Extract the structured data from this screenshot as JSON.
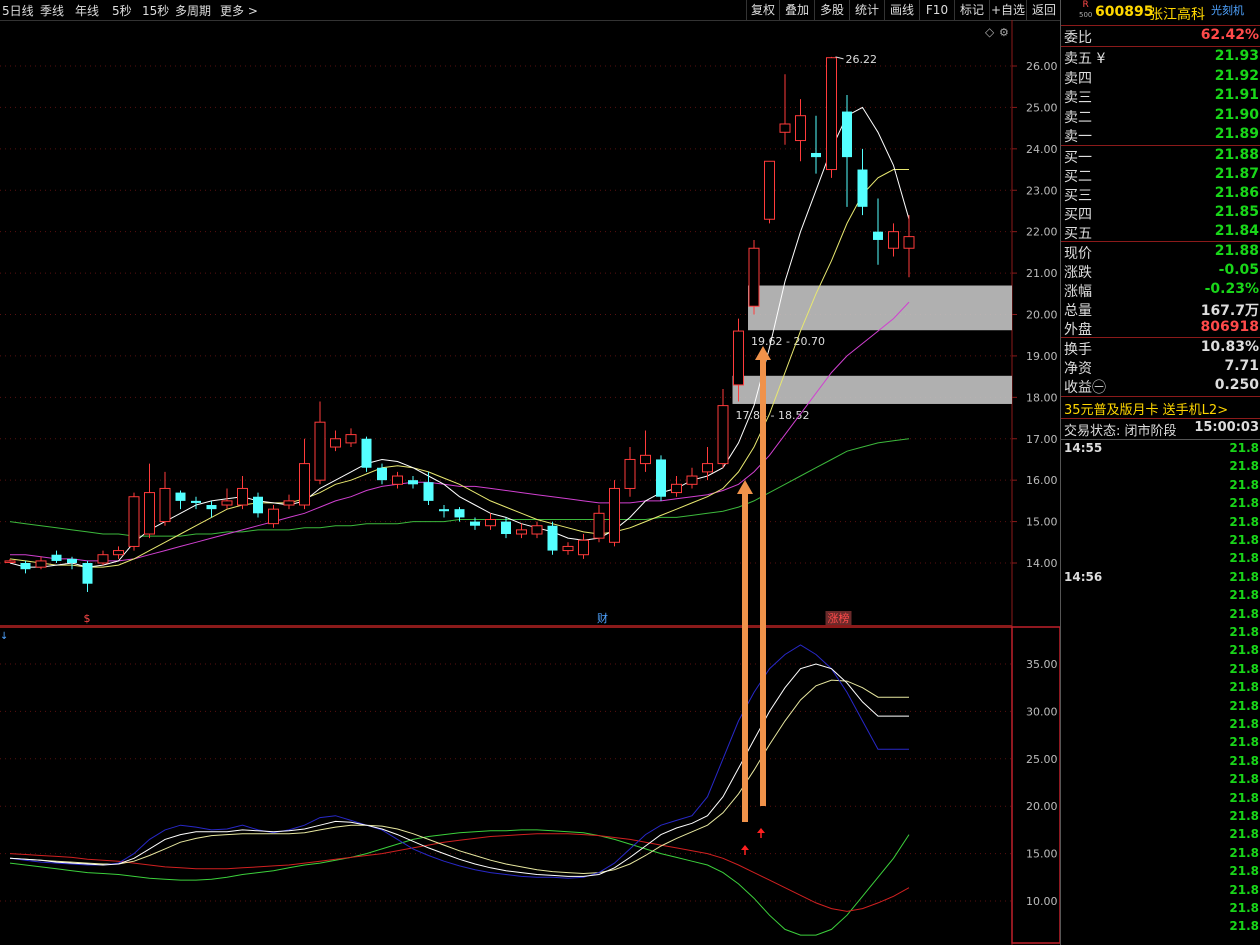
{
  "toolbar": {
    "periods": [
      "5日线",
      "季线",
      "年线",
      "5秒",
      "15秒",
      "多周期",
      "更多 >"
    ],
    "buttons": [
      "复权",
      "叠加",
      "多股",
      "统计",
      "画线",
      "F10",
      "标记",
      "+自选",
      "返回"
    ]
  },
  "stock": {
    "badge_top": "R",
    "badge_bottom": "500",
    "code": "600895",
    "name": "张江高科",
    "tag": "光刻机"
  },
  "quote": {
    "ratio_label": "委比",
    "ratio_value": "62.42%",
    "sell": [
      {
        "label": "卖五 ¥",
        "price": "21.93"
      },
      {
        "label": "卖四",
        "price": "21.92"
      },
      {
        "label": "卖三",
        "price": "21.91"
      },
      {
        "label": "卖二",
        "price": "21.90"
      },
      {
        "label": "卖一",
        "price": "21.89"
      }
    ],
    "buy": [
      {
        "label": "买一",
        "price": "21.88"
      },
      {
        "label": "买二",
        "price": "21.87"
      },
      {
        "label": "买三",
        "price": "21.86"
      },
      {
        "label": "买四",
        "price": "21.85"
      },
      {
        "label": "买五",
        "price": "21.84"
      }
    ],
    "stats1": [
      {
        "label": "现价",
        "value": "21.88",
        "color": "#19d619"
      },
      {
        "label": "涨跌",
        "value": "-0.05",
        "color": "#19d619"
      },
      {
        "label": "涨幅",
        "value": "-0.23%",
        "color": "#19d619"
      },
      {
        "label": "总量",
        "value": "167.7万",
        "color": "#dddddd"
      },
      {
        "label": "外盘",
        "value": "806918",
        "color": "#ff4a4a"
      }
    ],
    "stats2": [
      {
        "label": "换手",
        "value": "10.83%",
        "color": "#dddddd"
      },
      {
        "label": "净资",
        "value": "7.71",
        "color": "#dddddd"
      },
      {
        "label": "收益㊀",
        "value": "0.250",
        "color": "#dddddd"
      }
    ],
    "promo": "35元普及版月卡 送手机L2>",
    "status_label": "交易状态: 闭市阶段",
    "status_time": "15:00:03"
  },
  "ticks": {
    "time1": "14:55",
    "time2": "14:56",
    "price": "21.8"
  },
  "chart_data": {
    "type": "candlestick",
    "price_axis": {
      "ticks": [
        "26.00",
        "25.00",
        "24.00",
        "23.00",
        "22.00",
        "21.00",
        "20.00",
        "19.00",
        "18.00",
        "17.00",
        "16.00",
        "15.00",
        "14.00"
      ],
      "range": [
        13.0,
        27.0
      ]
    },
    "indicator_axis": {
      "ticks": [
        "35.00",
        "30.00",
        "25.00",
        "20.00",
        "15.00",
        "10.00"
      ],
      "range": [
        6.0,
        39.0
      ]
    },
    "max_label": "26.22",
    "zone_labels": [
      "19.62 - 20.70",
      "17.84 - 18.52"
    ],
    "zones": [
      [
        19.62,
        20.7
      ],
      [
        17.84,
        18.52
      ]
    ],
    "event_labels": [
      "$",
      "财",
      "涨榜"
    ],
    "event_x": [
      5,
      38,
      53
    ],
    "candles": [
      [
        14.05,
        14.05,
        14.1,
        14.0
      ],
      [
        14.0,
        13.85,
        14.05,
        13.75
      ],
      [
        13.9,
        14.05,
        14.15,
        13.85
      ],
      [
        14.2,
        14.05,
        14.3,
        14.0
      ],
      [
        14.1,
        14.0,
        14.15,
        13.85
      ],
      [
        14.0,
        13.5,
        14.05,
        13.3
      ],
      [
        14.0,
        14.2,
        14.3,
        13.95
      ],
      [
        14.2,
        14.3,
        14.4,
        14.1
      ],
      [
        14.4,
        15.6,
        15.7,
        14.3
      ],
      [
        14.7,
        15.7,
        16.4,
        14.6
      ],
      [
        15.0,
        15.8,
        16.2,
        14.9
      ],
      [
        15.7,
        15.5,
        15.75,
        15.3
      ],
      [
        15.5,
        15.45,
        15.6,
        15.3
      ],
      [
        15.4,
        15.3,
        15.5,
        15.1
      ],
      [
        15.4,
        15.5,
        15.8,
        15.3
      ],
      [
        15.4,
        15.8,
        16.1,
        15.3
      ],
      [
        15.6,
        15.2,
        15.7,
        15.1
      ],
      [
        14.95,
        15.3,
        15.4,
        14.85
      ],
      [
        15.4,
        15.5,
        15.65,
        15.3
      ],
      [
        15.4,
        16.4,
        17.0,
        15.3
      ],
      [
        16.0,
        17.4,
        17.9,
        15.9
      ],
      [
        16.8,
        17.0,
        17.2,
        16.7
      ],
      [
        16.9,
        17.1,
        17.25,
        16.8
      ],
      [
        17.0,
        16.3,
        17.05,
        16.2
      ],
      [
        16.3,
        16.0,
        16.4,
        15.9
      ],
      [
        15.9,
        16.1,
        16.2,
        15.8
      ],
      [
        16.0,
        15.9,
        16.1,
        15.8
      ],
      [
        15.95,
        15.5,
        16.2,
        15.4
      ],
      [
        15.3,
        15.25,
        15.4,
        15.1
      ],
      [
        15.3,
        15.1,
        15.35,
        15.0
      ],
      [
        15.0,
        14.9,
        15.1,
        14.8
      ],
      [
        14.9,
        15.05,
        15.2,
        14.8
      ],
      [
        15.0,
        14.7,
        15.1,
        14.6
      ],
      [
        14.7,
        14.8,
        14.95,
        14.6
      ],
      [
        14.7,
        14.9,
        15.0,
        14.6
      ],
      [
        14.9,
        14.3,
        15.0,
        14.2
      ],
      [
        14.3,
        14.4,
        14.5,
        14.2
      ],
      [
        14.2,
        14.55,
        14.7,
        14.1
      ],
      [
        14.6,
        15.2,
        15.4,
        14.5
      ],
      [
        14.5,
        15.8,
        16.0,
        14.4
      ],
      [
        15.8,
        16.5,
        16.8,
        15.6
      ],
      [
        16.4,
        16.6,
        17.2,
        16.2
      ],
      [
        16.5,
        15.6,
        16.6,
        15.5
      ],
      [
        15.7,
        15.9,
        16.1,
        15.6
      ],
      [
        15.9,
        16.1,
        16.3,
        15.8
      ],
      [
        16.2,
        16.4,
        16.8,
        16.0
      ],
      [
        16.4,
        17.8,
        18.2,
        16.3
      ],
      [
        18.3,
        19.6,
        19.9,
        17.9
      ],
      [
        20.2,
        21.6,
        21.8,
        20.0
      ],
      [
        22.3,
        23.7,
        23.7,
        22.2
      ],
      [
        24.4,
        24.6,
        25.8,
        24.1
      ],
      [
        24.2,
        24.8,
        25.2,
        23.7
      ],
      [
        23.9,
        23.8,
        24.8,
        23.4
      ],
      [
        23.5,
        26.2,
        26.22,
        23.3
      ],
      [
        24.9,
        23.8,
        25.3,
        22.6
      ],
      [
        23.5,
        22.6,
        24.0,
        22.4
      ],
      [
        22.0,
        21.8,
        22.8,
        21.2
      ],
      [
        21.6,
        22.0,
        22.2,
        21.4
      ],
      [
        21.6,
        21.88,
        22.4,
        20.9
      ]
    ],
    "ma_white": [
      14.0,
      13.9,
      13.9,
      13.95,
      14.0,
      13.9,
      13.95,
      14.05,
      14.5,
      14.8,
      15.0,
      15.2,
      15.4,
      15.5,
      15.55,
      15.6,
      15.5,
      15.45,
      15.4,
      15.5,
      15.8,
      16.0,
      16.2,
      16.4,
      16.5,
      16.45,
      16.3,
      16.1,
      15.9,
      15.6,
      15.4,
      15.2,
      15.1,
      14.95,
      14.85,
      14.75,
      14.6,
      14.55,
      14.6,
      14.8,
      15.1,
      15.5,
      15.7,
      15.8,
      16.0,
      16.1,
      16.3,
      16.9,
      17.8,
      19.2,
      20.8,
      22.0,
      23.0,
      24.0,
      24.8,
      25.0,
      24.4,
      23.6,
      22.3
    ],
    "ma_yellow": [
      14.1,
      14.05,
      14.0,
      13.95,
      13.95,
      13.9,
      13.9,
      13.95,
      14.1,
      14.3,
      14.5,
      14.7,
      14.9,
      15.1,
      15.3,
      15.4,
      15.45,
      15.45,
      15.45,
      15.55,
      15.7,
      15.9,
      16.0,
      16.15,
      16.3,
      16.35,
      16.3,
      16.2,
      16.05,
      15.9,
      15.7,
      15.5,
      15.35,
      15.2,
      15.05,
      14.95,
      14.85,
      14.75,
      14.7,
      14.75,
      14.85,
      15.0,
      15.15,
      15.3,
      15.45,
      15.6,
      15.8,
      16.2,
      16.8,
      17.6,
      18.6,
      19.6,
      20.5,
      21.3,
      22.2,
      22.9,
      23.3,
      23.5,
      23.5
    ],
    "ma_magenta": [
      14.2,
      14.2,
      14.15,
      14.1,
      14.1,
      14.05,
      14.05,
      14.05,
      14.1,
      14.2,
      14.3,
      14.4,
      14.5,
      14.6,
      14.7,
      14.8,
      14.9,
      15.0,
      15.1,
      15.2,
      15.35,
      15.5,
      15.6,
      15.75,
      15.85,
      15.9,
      15.95,
      15.95,
      15.9,
      15.85,
      15.85,
      15.8,
      15.75,
      15.7,
      15.65,
      15.6,
      15.55,
      15.5,
      15.45,
      15.45,
      15.45,
      15.5,
      15.5,
      15.55,
      15.6,
      15.65,
      15.75,
      15.9,
      16.2,
      16.6,
      17.1,
      17.6,
      18.1,
      18.6,
      19.0,
      19.3,
      19.6,
      19.9,
      20.3
    ],
    "ma_green": [
      15.0,
      14.95,
      14.9,
      14.85,
      14.8,
      14.75,
      14.7,
      14.7,
      14.65,
      14.65,
      14.65,
      14.65,
      14.7,
      14.7,
      14.75,
      14.75,
      14.8,
      14.8,
      14.8,
      14.85,
      14.85,
      14.9,
      14.9,
      14.95,
      14.95,
      14.95,
      15.0,
      15.0,
      15.0,
      15.05,
      15.05,
      15.05,
      15.05,
      15.05,
      15.05,
      15.05,
      15.05,
      15.05,
      15.05,
      15.05,
      15.05,
      15.05,
      15.1,
      15.1,
      15.15,
      15.2,
      15.25,
      15.35,
      15.5,
      15.7,
      15.9,
      16.1,
      16.3,
      16.5,
      16.7,
      16.8,
      16.9,
      16.95,
      17.0
    ],
    "ind_blue": [
      14.5,
      14.3,
      14.1,
      14.0,
      13.9,
      13.8,
      13.8,
      14.0,
      15.0,
      16.5,
      17.5,
      18.0,
      17.8,
      17.5,
      17.6,
      18.0,
      17.5,
      17.2,
      17.5,
      18.0,
      18.8,
      19.0,
      18.5,
      18.0,
      17.5,
      16.5,
      15.5,
      14.8,
      14.2,
      13.7,
      13.3,
      13.0,
      12.8,
      12.6,
      12.5,
      12.5,
      12.4,
      12.5,
      13.0,
      14.0,
      15.5,
      17.0,
      18.0,
      18.5,
      19.0,
      21.0,
      25.0,
      29.0,
      32.0,
      34.5,
      36.0,
      37.0,
      36.0,
      34.5,
      32.0,
      29.0,
      26.0,
      26.0,
      26.0
    ],
    "ind_white": [
      14.5,
      14.4,
      14.3,
      14.1,
      14.0,
      13.9,
      13.8,
      13.9,
      14.5,
      15.5,
      16.5,
      17.0,
      17.3,
      17.3,
      17.3,
      17.5,
      17.4,
      17.3,
      17.4,
      17.6,
      18.0,
      18.4,
      18.3,
      18.0,
      17.6,
      17.0,
      16.3,
      15.6,
      15.0,
      14.4,
      13.9,
      13.5,
      13.2,
      13.0,
      12.8,
      12.7,
      12.6,
      12.6,
      12.8,
      13.5,
      14.6,
      15.8,
      17.0,
      17.7,
      18.2,
      19.0,
      21.0,
      24.0,
      27.0,
      30.0,
      32.5,
      34.5,
      35.0,
      34.5,
      33.0,
      31.0,
      29.5,
      29.5,
      29.5
    ],
    "ind_yellow": [
      14.5,
      14.4,
      14.3,
      14.2,
      14.1,
      14.0,
      13.9,
      13.9,
      14.2,
      14.8,
      15.5,
      16.2,
      16.6,
      16.9,
      17.0,
      17.1,
      17.1,
      17.1,
      17.1,
      17.2,
      17.5,
      17.8,
      18.0,
      18.0,
      17.9,
      17.6,
      17.1,
      16.5,
      15.9,
      15.3,
      14.8,
      14.3,
      13.9,
      13.6,
      13.3,
      13.1,
      13.0,
      12.9,
      13.0,
      13.3,
      13.9,
      14.8,
      15.8,
      16.6,
      17.3,
      18.0,
      19.3,
      21.3,
      23.8,
      26.5,
      29.0,
      31.2,
      32.7,
      33.3,
      33.2,
      32.5,
      31.5,
      31.5,
      31.5
    ],
    "ind_green": [
      14.0,
      13.8,
      13.6,
      13.4,
      13.2,
      13.0,
      12.9,
      12.8,
      12.6,
      12.4,
      12.3,
      12.2,
      12.2,
      12.3,
      12.5,
      12.8,
      13.0,
      13.2,
      13.5,
      13.8,
      14.0,
      14.3,
      14.6,
      15.0,
      15.5,
      16.0,
      16.5,
      16.8,
      17.0,
      17.2,
      17.3,
      17.4,
      17.4,
      17.5,
      17.5,
      17.4,
      17.3,
      17.2,
      16.9,
      16.5,
      16.0,
      15.5,
      15.0,
      14.6,
      14.2,
      13.8,
      13.0,
      11.8,
      10.3,
      8.5,
      7.0,
      6.4,
      6.4,
      7.0,
      8.5,
      10.5,
      12.5,
      14.5,
      17.0
    ],
    "ind_red": [
      15.0,
      14.9,
      14.8,
      14.7,
      14.6,
      14.4,
      14.3,
      14.2,
      14.0,
      13.8,
      13.6,
      13.5,
      13.4,
      13.4,
      13.4,
      13.5,
      13.6,
      13.7,
      13.8,
      14.0,
      14.2,
      14.4,
      14.6,
      14.8,
      15.0,
      15.3,
      15.6,
      15.9,
      16.2,
      16.4,
      16.6,
      16.8,
      16.9,
      17.0,
      17.1,
      17.1,
      17.1,
      17.0,
      16.9,
      16.7,
      16.5,
      16.2,
      15.9,
      15.6,
      15.3,
      15.0,
      14.5,
      13.8,
      13.0,
      12.2,
      11.4,
      10.6,
      9.8,
      9.2,
      8.9,
      9.2,
      9.8,
      10.5,
      11.4
    ]
  }
}
